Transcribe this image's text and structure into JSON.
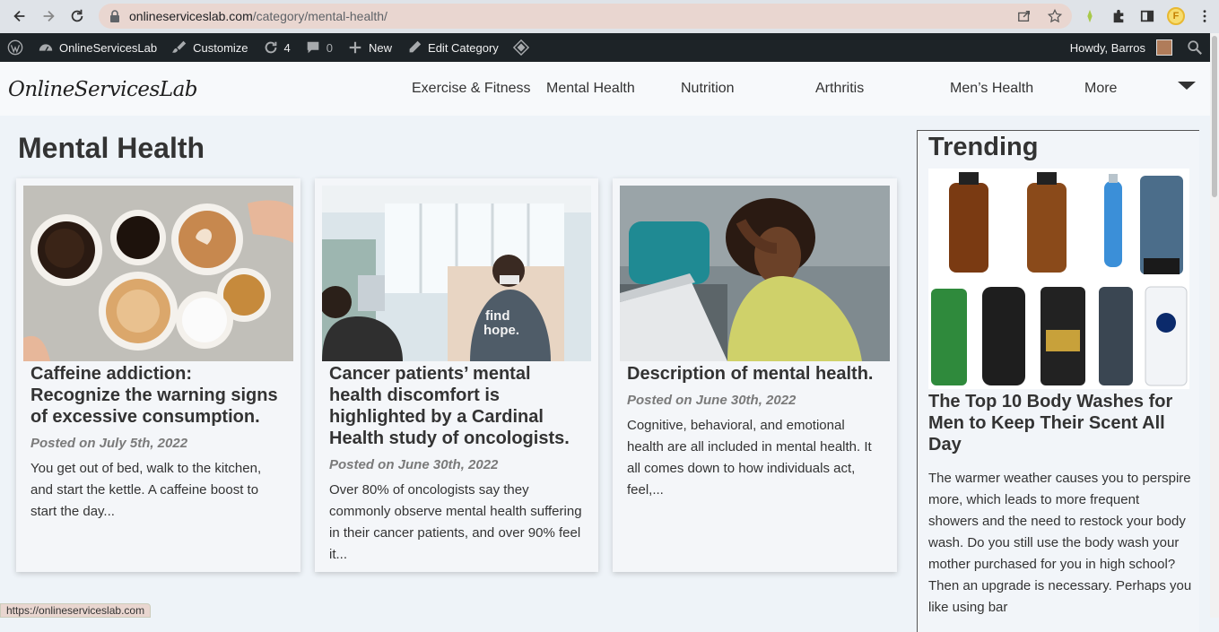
{
  "browser": {
    "url_host": "onlineserviceslab.com",
    "url_path": "/category/mental-health/",
    "profile_initial": "F",
    "status_url": "https://onlineserviceslab.com"
  },
  "admin_bar": {
    "site_name": "OnlineServicesLab",
    "customize": "Customize",
    "updates_count": "4",
    "comments_count": "0",
    "new_label": "New",
    "edit_label": "Edit Category",
    "howdy": "Howdy, Barros"
  },
  "header": {
    "logo": "OnlineServicesLab",
    "menu": [
      "Exercise & Fitness",
      "Mental Health",
      "Nutrition",
      "Arthritis",
      "Men’s Health",
      "More"
    ]
  },
  "main": {
    "page_title": "Mental Health",
    "posts": [
      {
        "title": "Caffeine addiction: Recognize the warning signs of excessive consumption.",
        "date": "Posted on July 5th, 2022",
        "excerpt": "You get out of bed, walk to the kitchen, and start the kettle. A caffeine boost to start the day..."
      },
      {
        "title": "Cancer patients’ mental health discomfort is highlighted by a Cardinal Health study of oncologists.",
        "date": "Posted on June 30th, 2022",
        "excerpt": "Over 80% of oncologists say they commonly observe mental health suffering in their cancer patients, and over 90% feel it..."
      },
      {
        "title": "Description of mental health.",
        "date": "Posted on June 30th, 2022",
        "excerpt": "Cognitive, behavioral, and emotional health are all included in mental health. It all comes down to how individuals act, feel,..."
      }
    ]
  },
  "sidebar": {
    "title": "Trending",
    "post_title": "The Top 10 Body Washes for Men to Keep Their Scent All Day",
    "excerpt": "The warmer weather causes you to perspire more, which leads to more frequent showers and the need to restock your body wash. Do you still use the body wash your mother purchased for you in high school? Then an upgrade is necessary. Perhaps you like using bar"
  },
  "colors": {
    "admin_bar": "#1d2327",
    "page_bg": "#eef3f8",
    "address_bar": "#e9d6d0"
  }
}
